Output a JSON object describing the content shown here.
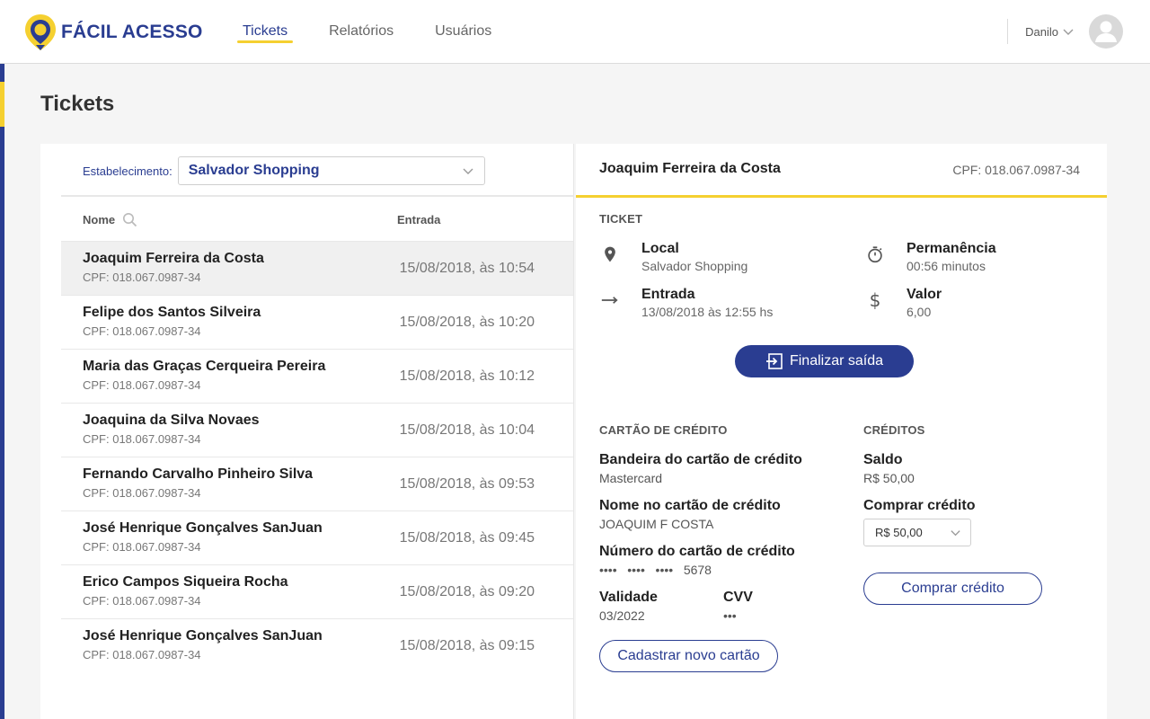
{
  "brand": {
    "name": "FÁCIL ACESSO",
    "primary": "#2a3d91",
    "accent": "#f5d030"
  },
  "nav": {
    "items": [
      {
        "label": "Tickets",
        "active": true
      },
      {
        "label": "Relatórios",
        "active": false
      },
      {
        "label": "Usuários",
        "active": false
      }
    ]
  },
  "user": {
    "name": "Danilo",
    "icon": "chevron-down-icon"
  },
  "page": {
    "title": "Tickets"
  },
  "filter": {
    "label": "Estabelecimento:",
    "value": "Salvador Shopping"
  },
  "list": {
    "columns": {
      "name": "Nome",
      "entry": "Entrada"
    },
    "rows": [
      {
        "name": "Joaquim Ferreira da Costa",
        "cpf": "CPF: 018.067.0987-34",
        "date": "15/08/2018, às 10:54",
        "selected": true
      },
      {
        "name": "Felipe dos Santos Silveira",
        "cpf": "CPF: 018.067.0987-34",
        "date": "15/08/2018, às 10:20",
        "selected": false
      },
      {
        "name": "Maria das Graças Cerqueira Pereira",
        "cpf": "CPF: 018.067.0987-34",
        "date": "15/08/2018, às 10:12",
        "selected": false
      },
      {
        "name": "Joaquina da Silva Novaes",
        "cpf": "CPF: 018.067.0987-34",
        "date": "15/08/2018, às 10:04",
        "selected": false
      },
      {
        "name": "Fernando Carvalho Pinheiro Silva",
        "cpf": "CPF: 018.067.0987-34",
        "date": "15/08/2018, às 09:53",
        "selected": false
      },
      {
        "name": "José Henrique Gonçalves SanJuan",
        "cpf": "CPF: 018.067.0987-34",
        "date": "15/08/2018, às 09:45",
        "selected": false
      },
      {
        "name": "Erico Campos Siqueira Rocha",
        "cpf": "CPF: 018.067.0987-34",
        "date": "15/08/2018, às 09:20",
        "selected": false
      },
      {
        "name": "José Henrique Gonçalves SanJuan",
        "cpf": "CPF: 018.067.0987-34",
        "date": "15/08/2018, às 09:15",
        "selected": false
      }
    ]
  },
  "detail": {
    "name": "Joaquim Ferreira da Costa",
    "cpf": "CPF: 018.067.0987-34",
    "ticket": {
      "title": "TICKET",
      "local_label": "Local",
      "local_value": "Salvador Shopping",
      "stay_label": "Permanência",
      "stay_value": "00:56 minutos",
      "entry_label": "Entrada",
      "entry_value": "13/08/2018 às 12:55 hs",
      "value_label": "Valor",
      "value_value": "6,00",
      "finish_button": "Finalizar saída"
    },
    "card": {
      "title": "CARTÃO DE CRÉDITO",
      "brand_label": "Bandeira do cartão de crédito",
      "brand_value": "Mastercard",
      "holder_label": "Nome no cartão de crédito",
      "holder_value": "JOAQUIM F COSTA",
      "number_label": "Número do cartão de crédito",
      "number_value": "••••   ••••   ••••   5678",
      "expiry_label": "Validade",
      "expiry_value": "03/2022",
      "cvv_label": "CVV",
      "cvv_value": "•••",
      "new_card_button": "Cadastrar novo cartão"
    },
    "credits": {
      "title": "CRÉDITOS",
      "balance_label": "Saldo",
      "balance_value": "R$ 50,00",
      "buy_label": "Comprar crédito",
      "buy_select": "R$ 50,00",
      "buy_button": "Comprar crédito"
    }
  }
}
